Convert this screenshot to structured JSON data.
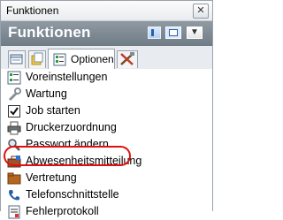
{
  "window": {
    "title": "Funktionen",
    "close_glyph": "✕"
  },
  "panel": {
    "header": "Funktionen"
  },
  "tabs": [
    {
      "icon": "document-list-icon"
    },
    {
      "icon": "folder-pages-icon"
    },
    {
      "icon": "options-list-icon",
      "label": "Optionen",
      "active": true
    },
    {
      "icon": "tools-icon"
    }
  ],
  "items": [
    {
      "label": "Voreinstellungen",
      "icon": "settings-list-icon"
    },
    {
      "label": "Wartung",
      "icon": "wrench-icon"
    },
    {
      "label": "Job starten",
      "icon": "checkbox-icon"
    },
    {
      "label": "Druckerzuordnung",
      "icon": "printer-icon"
    },
    {
      "label": "Passwort ändern",
      "icon": "magnifier-key-icon"
    },
    {
      "label": "Abwesenheitsmitteilung",
      "icon": "briefcase-icon",
      "highlighted": true
    },
    {
      "label": "Vertretung",
      "icon": "folder-user-icon"
    },
    {
      "label": "Telefonschnittstelle",
      "icon": "phone-icon"
    },
    {
      "label": "Fehlerprotokoll",
      "icon": "error-log-icon"
    }
  ],
  "colors": {
    "highlight_ring": "#e01010",
    "header_bg": "#7b8690"
  }
}
